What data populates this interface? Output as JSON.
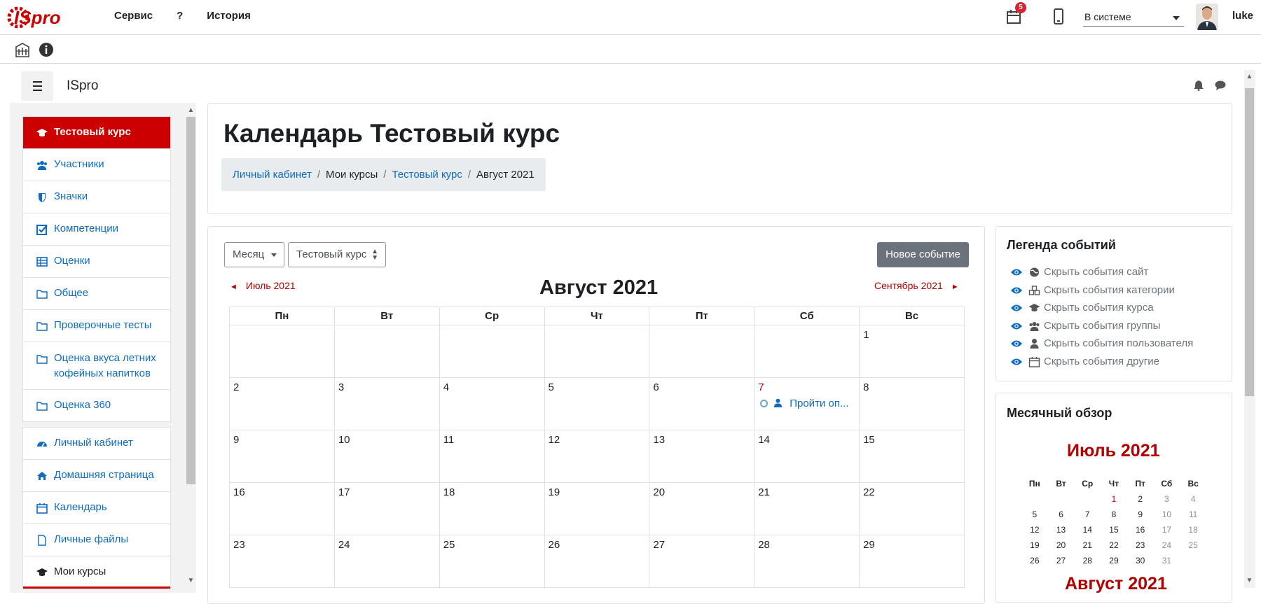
{
  "app": {
    "logo_text": "ISpro",
    "menu": [
      "Сервис",
      "?",
      "История"
    ],
    "notifications_count": "5",
    "status": "В системе",
    "username": "luke"
  },
  "moodle": {
    "brand": "ISpro"
  },
  "sidebar": {
    "course_items": [
      {
        "label": "Тестовый курс",
        "icon": "graduation-cap-icon"
      },
      {
        "label": "Участники",
        "icon": "users-icon"
      },
      {
        "label": "Значки",
        "icon": "shield-icon"
      },
      {
        "label": "Компетенции",
        "icon": "checkbox-icon"
      },
      {
        "label": "Оценки",
        "icon": "table-icon"
      },
      {
        "label": "Общее",
        "icon": "folder-icon"
      },
      {
        "label": "Проверочные тесты",
        "icon": "folder-icon"
      },
      {
        "label": "Оценка вкуса летних кофейных напитков",
        "icon": "folder-icon"
      },
      {
        "label": "Оценка 360",
        "icon": "folder-icon"
      }
    ],
    "site_items": [
      {
        "label": "Личный кабинет",
        "icon": "dashboard-icon"
      },
      {
        "label": "Домашняя страница",
        "icon": "home-icon"
      },
      {
        "label": "Календарь",
        "icon": "calendar-icon"
      },
      {
        "label": "Личные файлы",
        "icon": "file-icon"
      },
      {
        "label": "Мои курсы",
        "icon": "graduation-cap-icon"
      }
    ]
  },
  "page": {
    "title": "Календарь Тестовый курс",
    "breadcrumb": [
      "Личный кабинет",
      "Мои курсы",
      "Тестовый курс",
      "Август 2021"
    ]
  },
  "calendar": {
    "view_select": "Месяц",
    "course_select": "Тестовый курс",
    "new_event_button": "Новое событие",
    "prev_month": "Июль 2021",
    "next_month": "Сентябрь 2021",
    "month_title": "Август 2021",
    "weekdays": [
      "Пн",
      "Вт",
      "Ср",
      "Чт",
      "Пт",
      "Сб",
      "Вс"
    ],
    "weeks": [
      [
        "",
        "",
        "",
        "",
        "",
        "",
        "1"
      ],
      [
        "2",
        "3",
        "4",
        "5",
        "6",
        "7",
        "8"
      ],
      [
        "9",
        "10",
        "11",
        "12",
        "13",
        "14",
        "15"
      ],
      [
        "16",
        "17",
        "18",
        "19",
        "20",
        "21",
        "22"
      ],
      [
        "23",
        "24",
        "25",
        "26",
        "27",
        "28",
        "29"
      ]
    ],
    "event_text": "Пройти оп..."
  },
  "legend": {
    "title": "Легенда событий",
    "items": [
      {
        "label": "Скрыть события сайт",
        "icon": "globe-icon"
      },
      {
        "label": "Скрыть события категории",
        "icon": "cubes-icon"
      },
      {
        "label": "Скрыть события курса",
        "icon": "graduation-cap-icon"
      },
      {
        "label": "Скрыть события группы",
        "icon": "users-icon"
      },
      {
        "label": "Скрыть события пользователя",
        "icon": "user-icon"
      },
      {
        "label": "Скрыть события другие",
        "icon": "calendar-icon"
      }
    ]
  },
  "overview": {
    "title": "Месячный обзор",
    "month1": "Июль 2021",
    "month2": "Август 2021",
    "weekdays": [
      "Пн",
      "Вт",
      "Ср",
      "Чт",
      "Пт",
      "Сб",
      "Вс"
    ],
    "weeks": [
      [
        "",
        "",
        "",
        "1",
        "2",
        "3",
        "4"
      ],
      [
        "5",
        "6",
        "7",
        "8",
        "9",
        "10",
        "11"
      ],
      [
        "12",
        "13",
        "14",
        "15",
        "16",
        "17",
        "18"
      ],
      [
        "19",
        "20",
        "21",
        "22",
        "23",
        "24",
        "25"
      ],
      [
        "26",
        "27",
        "28",
        "29",
        "30",
        "31",
        ""
      ]
    ]
  },
  "colors": {
    "accent_red": "#c00000",
    "link_blue": "#0f6cbf",
    "muted": "#6a737b"
  }
}
